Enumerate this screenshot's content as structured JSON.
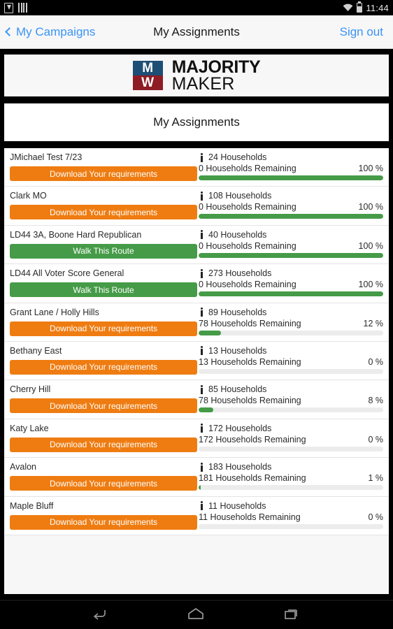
{
  "status_bar": {
    "icons_left": [
      "download-icon",
      "sim-bars-icon"
    ],
    "icons_right": [
      "wifi-icon",
      "battery-icon"
    ],
    "clock": "11:44"
  },
  "nav_bar": {
    "back_label": "My Campaigns",
    "title": "My Assignments",
    "signout_label": "Sign out",
    "link_color": "#3a93f6"
  },
  "logo": {
    "mark_top_letter": "M",
    "mark_bottom_letter": "W",
    "word_line1": "MAJORITY",
    "word_line2": "MAKER",
    "blue": "#1d4e75",
    "red": "#8e1c24"
  },
  "page_title": "My Assignments",
  "colors": {
    "orange_button": "#ef7c11",
    "green_button": "#459b47",
    "progress_fill": "#459b47",
    "progress_track": "#ececec"
  },
  "list": {
    "button_labels": {
      "download": "Download Your requirements",
      "walk": "Walk This Route"
    },
    "rows": [
      {
        "name": "JMichael Test 7/23",
        "action": "Download Your requirements",
        "action_type": "download",
        "households": "24 Households",
        "remaining": "0 Households Remaining",
        "percent_label": "100 %",
        "percent": 100
      },
      {
        "name": "Clark MO",
        "action": "Download Your requirements",
        "action_type": "download",
        "households": "108 Households",
        "remaining": "0 Households Remaining",
        "percent_label": "100 %",
        "percent": 100
      },
      {
        "name": "LD44 3A, Boone Hard Republican",
        "action": "Walk This Route",
        "action_type": "walk",
        "households": "40 Households",
        "remaining": "0 Households Remaining",
        "percent_label": "100 %",
        "percent": 100
      },
      {
        "name": "LD44 All Voter Score General",
        "action": "Walk This Route",
        "action_type": "walk",
        "households": "273 Households",
        "remaining": "0 Households Remaining",
        "percent_label": "100 %",
        "percent": 100
      },
      {
        "name": "Grant Lane / Holly Hills",
        "action": "Download Your requirements",
        "action_type": "download",
        "households": "89 Households",
        "remaining": "78 Households Remaining",
        "percent_label": "12 %",
        "percent": 12
      },
      {
        "name": "Bethany East",
        "action": "Download Your requirements",
        "action_type": "download",
        "households": "13 Households",
        "remaining": "13 Households Remaining",
        "percent_label": "0 %",
        "percent": 0
      },
      {
        "name": "Cherry Hill",
        "action": "Download Your requirements",
        "action_type": "download",
        "households": "85 Households",
        "remaining": "78 Households Remaining",
        "percent_label": "8 %",
        "percent": 8
      },
      {
        "name": "Katy Lake",
        "action": "Download Your requirements",
        "action_type": "download",
        "households": "172 Households",
        "remaining": "172 Households Remaining",
        "percent_label": "0 %",
        "percent": 0
      },
      {
        "name": "Avalon",
        "action": "Download Your requirements",
        "action_type": "download",
        "households": "183 Households",
        "remaining": "181 Households Remaining",
        "percent_label": "1 %",
        "percent": 1
      },
      {
        "name": "Maple Bluff",
        "action": "Download Your requirements",
        "action_type": "download",
        "households": "11 Households",
        "remaining": "11 Households Remaining",
        "percent_label": "0 %",
        "percent": 0
      }
    ]
  },
  "soft_keys": [
    "back-icon",
    "home-icon",
    "recents-icon"
  ]
}
